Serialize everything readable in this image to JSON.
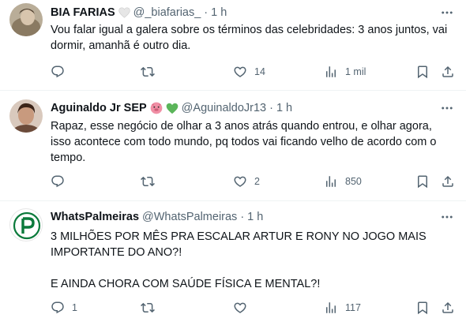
{
  "colors": {
    "text": "#0f1419",
    "muted": "#536471",
    "divider": "#eff3f4",
    "palmeiras_green": "#0b7a3b",
    "heart_badge": "#e8e8e8",
    "green_heart": "#5bb55a",
    "pig_pink": "#f08fa5"
  },
  "tweets": [
    {
      "name": "BIA FARIAS",
      "badge": "white-heart-emoji",
      "handle": "@_biafarias_",
      "sep": "·",
      "time": "1 h",
      "text": "Vou falar igual a galera sobre os términos das celebridades: 3 anos juntos, vai dormir, amanhã é outro dia.",
      "replies": "",
      "retweets": "",
      "likes": "14",
      "views": "1 mil"
    },
    {
      "name": "Aguinaldo Jr SEP",
      "badge": "pig-face-and-green-heart-emoji",
      "handle": "@AguinaldoJr13",
      "sep": "·",
      "time": "1 h",
      "text": "Rapaz, esse negócio de olhar a 3 anos atrás quando entrou, e olhar agora, isso acontece com todo mundo, pq todos vai ficando velho de acordo com o tempo.",
      "replies": "",
      "retweets": "",
      "likes": "2",
      "views": "850"
    },
    {
      "name": "WhatsPalmeiras",
      "badge": "",
      "handle": "@WhatsPalmeiras",
      "sep": "·",
      "time": "1 h",
      "text": "3 MILHÕES POR MÊS PRA ESCALAR ARTUR E RONY NO JOGO MAIS IMPORTANTE DO ANO?!\n\nE AINDA CHORA COM SAÚDE FÍSICA E MENTAL?!",
      "replies": "1",
      "retweets": "",
      "likes": "",
      "views": "117"
    }
  ]
}
